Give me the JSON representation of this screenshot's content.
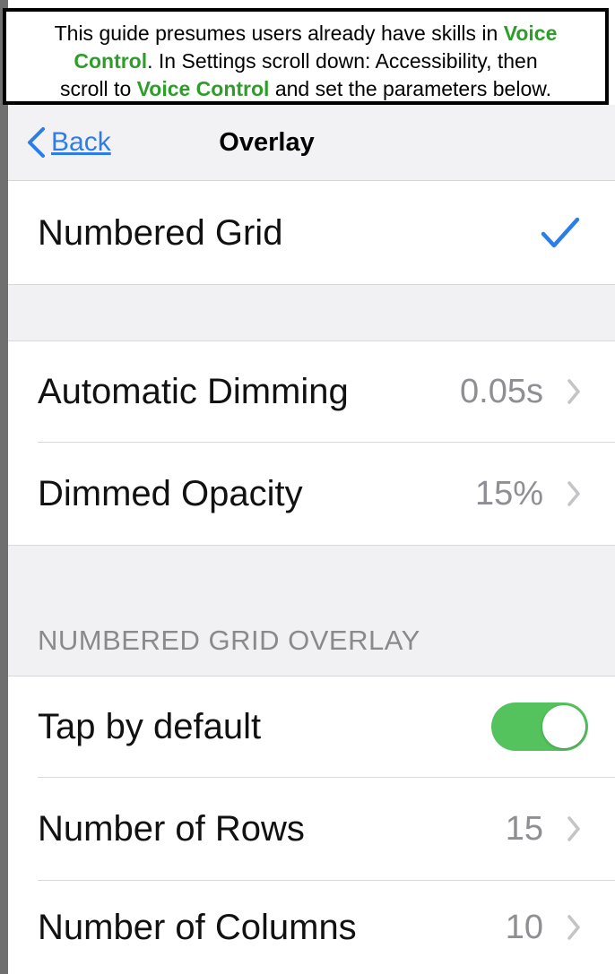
{
  "banner": {
    "line1_a": "This guide presumes users already have skills in ",
    "line1_b": "Voice",
    "line2_a": "Control",
    "line2_b": ". In Settings scroll down: Accessibility, then",
    "line3_a": "scroll to ",
    "line3_b": "Voice Control",
    "line3_c": " and set the parameters below."
  },
  "navbar": {
    "back_label": "Back",
    "title": "Overlay"
  },
  "overlay_option": {
    "label": "Numbered Grid",
    "selected": true
  },
  "dimming": {
    "automatic_label": "Automatic Dimming",
    "automatic_value": "0.05s",
    "opacity_label": "Dimmed Opacity",
    "opacity_value": "15%"
  },
  "grid_section": {
    "header": "NUMBERED GRID OVERLAY",
    "tap_label": "Tap by default",
    "tap_on": true,
    "rows_label": "Number of Rows",
    "rows_value": "15",
    "cols_label": "Number of Columns",
    "cols_value": "10"
  },
  "colors": {
    "accent_blue": "#2b7de9",
    "toggle_green": "#55c35d",
    "highlight_green": "#2e9e2a"
  }
}
